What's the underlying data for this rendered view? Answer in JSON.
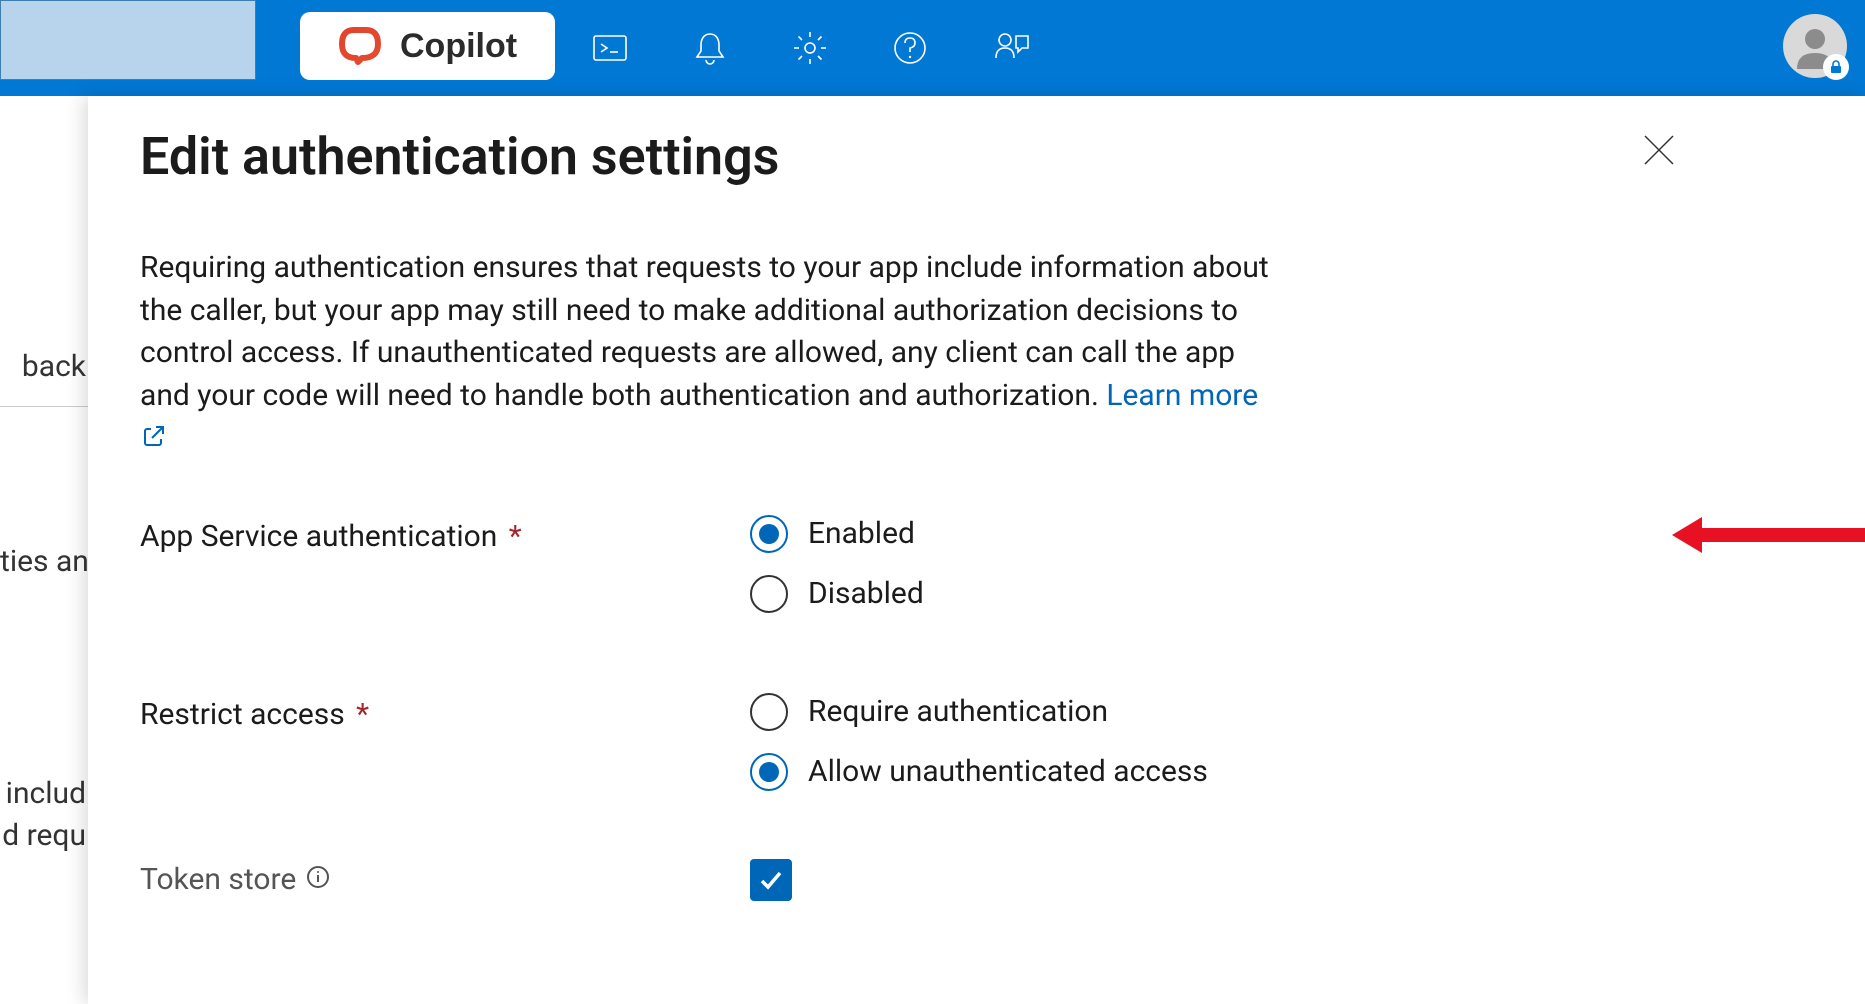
{
  "header": {
    "copilot_label": "Copilot"
  },
  "underpage": {
    "line1": "back",
    "line2": "ties and",
    "line3": "includ",
    "line4": "d requ"
  },
  "panel": {
    "title": "Edit authentication settings",
    "description_lead": "Requiring authentication ensures that requests to your app include information about the caller, but your app may still need to make additional authorization decisions to control access. If unauthenticated requests are allowed, any client can call the app and your code will need to handle both authentication and authorization. ",
    "learn_more": "Learn more",
    "fields": {
      "app_auth_label": "App Service authentication",
      "app_auth_options": {
        "enabled": "Enabled",
        "disabled": "Disabled"
      },
      "restrict_label": "Restrict access",
      "restrict_options": {
        "require": "Require authentication",
        "allow": "Allow unauthenticated access"
      },
      "token_store_label": "Token store"
    }
  }
}
